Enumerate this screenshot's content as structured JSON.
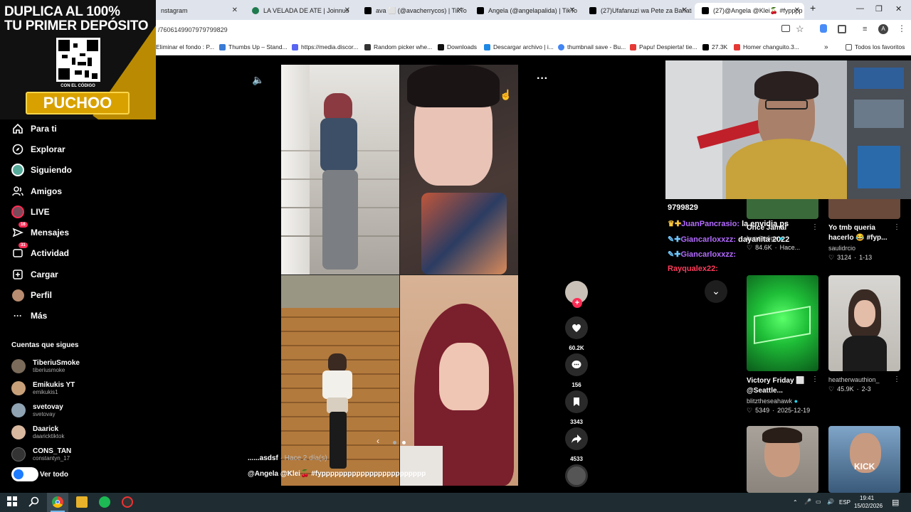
{
  "browser": {
    "tabs": [
      {
        "label": "nstagram",
        "color": "#d84b8a"
      },
      {
        "label": "LA VELADA DE ATE | Joinnus",
        "color": "#1f7a4e"
      },
      {
        "label": "ava ⬜ (@avacherrycos) | TikTok",
        "color": "#000000"
      },
      {
        "label": "Angela (@angelapalida) | TikTo",
        "color": "#000000"
      },
      {
        "label": "(27)Ufafanuzi wa Pete za Bahati",
        "color": "#000000"
      },
      {
        "label": "(27)@Angela @Klei🍒 #fypppp",
        "color": "#000000"
      }
    ],
    "url": "/7606149907979799829",
    "bookmarks": [
      {
        "label": "Eliminar el fondo : P...",
        "color": "#666666"
      },
      {
        "label": "Thumbs Up – Stand...",
        "color": "#3a7bd5"
      },
      {
        "label": "https://media.discor...",
        "color": "#5865f2"
      },
      {
        "label": "Random picker whe...",
        "color": "#333333"
      },
      {
        "label": "Downloads",
        "color": "#111111"
      },
      {
        "label": "Descargar archivo | i...",
        "color": "#1e88e5"
      },
      {
        "label": "thumbnail save - Bu...",
        "color": "#4285f4"
      },
      {
        "label": "Papu! Despierta! tie...",
        "color": "#e53935"
      },
      {
        "label": "27.3K",
        "color": "#000000"
      },
      {
        "label": "Homer changuito.3...",
        "color": "#e53935"
      }
    ],
    "all_favorites": "Todos los favoritos"
  },
  "promo": {
    "line1": "DUPLICA AL 100%",
    "line2": "TU PRIMER DEPÓSITO",
    "code_label": "CON EL CÓDIGO",
    "code": "PUCHOO"
  },
  "sidebar": {
    "items": [
      {
        "label": "Para ti",
        "icon": "home-icon"
      },
      {
        "label": "Explorar",
        "icon": "compass-icon"
      },
      {
        "label": "Siguiendo",
        "icon": "following-icon"
      },
      {
        "label": "Amigos",
        "icon": "friends-icon"
      },
      {
        "label": "LIVE",
        "icon": "live-icon"
      },
      {
        "label": "Mensajes",
        "icon": "messages-icon",
        "badge": "16"
      },
      {
        "label": "Actividad",
        "icon": "activity-icon",
        "badge": "31"
      },
      {
        "label": "Cargar",
        "icon": "upload-icon"
      },
      {
        "label": "Perfil",
        "icon": "profile-icon"
      },
      {
        "label": "Más",
        "icon": "more-icon"
      }
    ],
    "following_title": "Cuentas que sigues",
    "following": [
      {
        "name": "TiberiuSmoke",
        "handle": "tiberiusmoke",
        "color": "#7a6b5a"
      },
      {
        "name": "Emikukis YT",
        "handle": "emikukis1",
        "color": "#c7a07a"
      },
      {
        "name": "svetovay",
        "handle": "svetovay",
        "color": "#8fa3b3"
      },
      {
        "name": "Daarick",
        "handle": "daaricktiktok",
        "color": "#d9b8a0"
      },
      {
        "name": "CONS_TAN",
        "handle": "constantyn_17",
        "color": "#333333"
      }
    ],
    "see_all": "Ver todo"
  },
  "video": {
    "caption_user": "......asdsf",
    "caption_time": " · Hace 2 día(s)",
    "caption_text": "@Angela @Klei🍒 #fypppppppppppppppppppppppp"
  },
  "actions": {
    "likes": "60.2K",
    "comments": "156",
    "saves": "3343",
    "shares": "4533"
  },
  "chat": [
    {
      "user": "9799829",
      "text": "",
      "color": "#ffffff"
    },
    {
      "user": "JuanPancrasio:",
      "text": "la envidia ps",
      "color": "#b36bff"
    },
    {
      "user": "Giancarloxxzz:",
      "text": "dayanita 2022",
      "color": "#b36bff"
    },
    {
      "user": "Giancarloxxzz:",
      "text": "",
      "color": "#b36bff"
    },
    {
      "user": "Rayqualex22:",
      "text": "",
      "color": "#ff3b5c"
    }
  ],
  "recommendations": [
    {
      "title": "Once Jamal",
      "user": "bundesliga",
      "likes": "84.6K",
      "date": "Hace...",
      "verified": true
    },
    {
      "title": "Yo tmb queria hacerlo 😂 #fyp...",
      "user": "saulidrcio",
      "likes": "3124",
      "date": "1-13",
      "verified": false
    },
    {
      "title": "Victory Friday ⬜ @Seattle...",
      "user": "blitztheseahawk",
      "likes": "5349",
      "date": "2025-12-19",
      "verified": true
    },
    {
      "title": "",
      "user": "heatherwauthion_",
      "likes": "45.9K",
      "date": "2-3",
      "verified": false
    },
    {
      "title": "",
      "user": "",
      "likes": "",
      "date": "",
      "verified": false
    },
    {
      "title": "KICK",
      "user": "",
      "likes": "",
      "date": "",
      "verified": false
    }
  ],
  "taskbar": {
    "lang": "ESP",
    "time": "19:41",
    "date": "15/02/2026"
  }
}
